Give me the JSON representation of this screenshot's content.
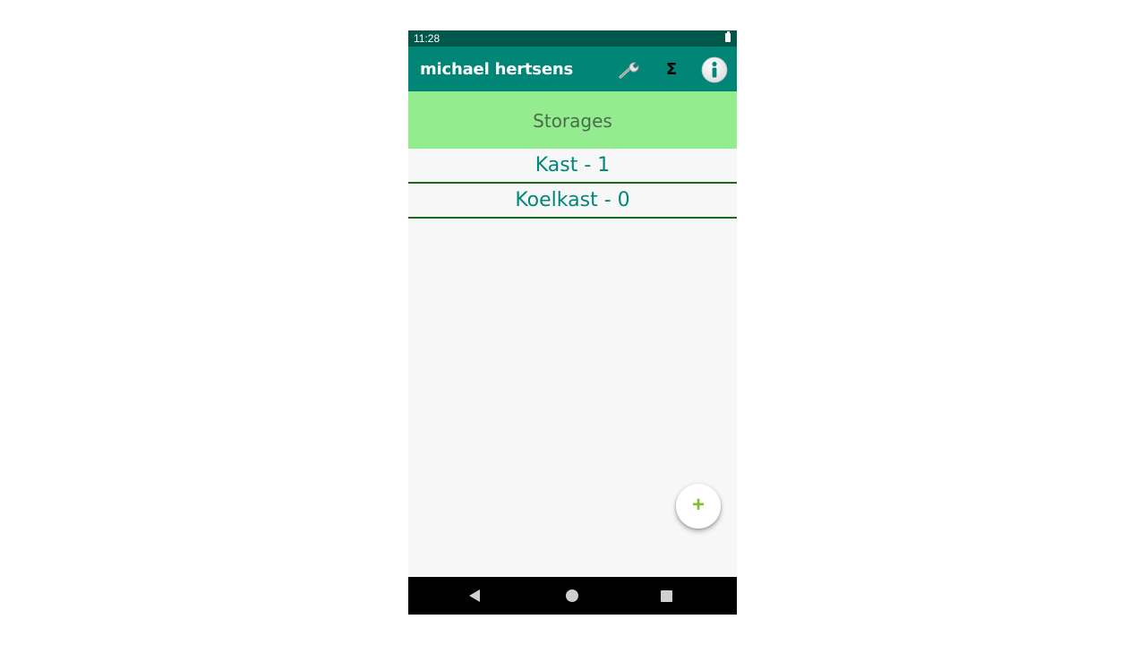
{
  "status_bar": {
    "time": "11:28"
  },
  "app_bar": {
    "title": "michael hertsens",
    "actions": [
      {
        "icon": "wrench-icon"
      },
      {
        "icon": "sigma-icon",
        "glyph": "Σ"
      },
      {
        "icon": "info-icon"
      }
    ]
  },
  "header": {
    "title": "Storages"
  },
  "storages": [
    {
      "label": "Kast - 1"
    },
    {
      "label": "Koelkast - 0"
    }
  ],
  "fab": {
    "label": "+"
  },
  "colors": {
    "status_bar": "#00574b",
    "app_bar": "#008577",
    "header_banner": "#93ec8e",
    "list_text": "#00877a",
    "divider": "#1c6a1c",
    "fab_plus": "#7cc230"
  }
}
